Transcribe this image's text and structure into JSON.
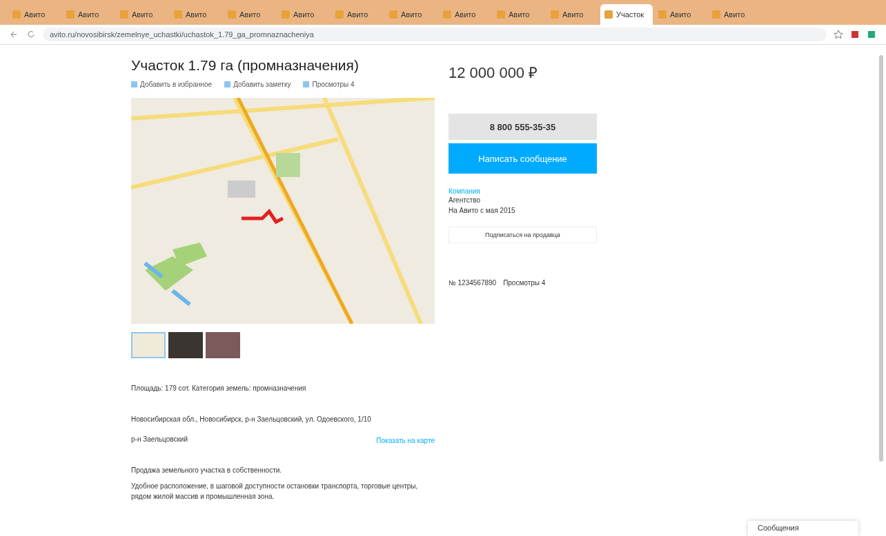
{
  "browser": {
    "tabs": [
      {
        "title": "Авито",
        "selected": false
      },
      {
        "title": "Авито",
        "selected": false
      },
      {
        "title": "Авито",
        "selected": false
      },
      {
        "title": "Авито",
        "selected": false
      },
      {
        "title": "Авито",
        "selected": false
      },
      {
        "title": "Авито",
        "selected": false
      },
      {
        "title": "Авито",
        "selected": false
      },
      {
        "title": "Авито",
        "selected": false
      },
      {
        "title": "Авито",
        "selected": false
      },
      {
        "title": "Авито",
        "selected": false
      },
      {
        "title": "Авито",
        "selected": false
      },
      {
        "title": "Участок",
        "selected": true
      },
      {
        "title": "Авито",
        "selected": false
      },
      {
        "title": "Авито",
        "selected": false
      }
    ],
    "url": "avito.ru/novosibirsk/zemelnye_uchastki/uchastok_1.79_ga_promnaznacheniya"
  },
  "listing": {
    "title": "Участок 1.79 га (промназначения)",
    "actions": [
      "Добавить в избранное",
      "Добавить заметку",
      "Просмотры 4"
    ],
    "price": "12 000 000 ₽",
    "phone": "8 800 555-35-35",
    "message_button": "Написать сообщение",
    "seller": {
      "name": "Компания",
      "type": "Агентство",
      "since": "На Авито с мая 2015"
    },
    "subscribe_button": "Подписаться на продавца",
    "ad_number": "№ 1234567890",
    "views": "Просмотры 4",
    "params": [
      {
        "label": "Площадь:",
        "value": "179 сот."
      },
      {
        "label": "Категория земель:",
        "value": "промназначения"
      }
    ],
    "address": "Новосибирская обл., Новосибирск, р-н Заельцовский, ул. Одоевского, 1/10",
    "district": "р-н Заельцовский",
    "map_link": "Показать на карте",
    "description_title": "Продажа земельного участка в собственности.",
    "description": "Удобное расположение, в шаговой доступности остановки транспорта, торговые центры, рядом жилой массив и промышленная зона.",
    "chat": "Сообщения"
  }
}
